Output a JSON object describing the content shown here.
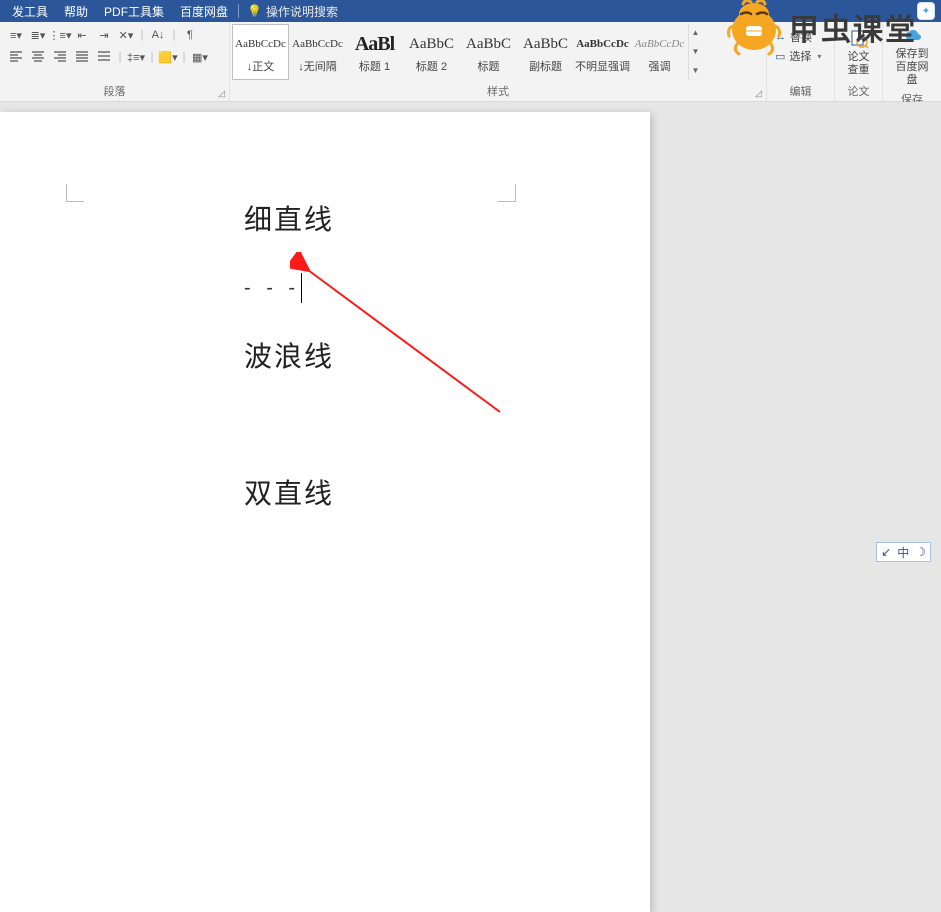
{
  "menubar": {
    "tab_dev": "发工具",
    "tab_help": "帮助",
    "tab_pdf": "PDF工具集",
    "tab_baidu": "百度网盘",
    "search_placeholder": "操作说明搜索"
  },
  "ribbon": {
    "paragraph_label": "段落",
    "styles_label": "样式",
    "edit_label": "编辑",
    "lunwen_label": "论文",
    "baocun_label": "保存",
    "styles": [
      {
        "preview": "AaBbCcDc",
        "name": "↓正文",
        "cls": ""
      },
      {
        "preview": "AaBbCcDc",
        "name": "↓无间隔",
        "cls": ""
      },
      {
        "preview": "AaBl",
        "name": "标题 1",
        "cls": "big"
      },
      {
        "preview": "AaBbC",
        "name": "标题 2",
        "cls": "h"
      },
      {
        "preview": "AaBbC",
        "name": "标题",
        "cls": "h"
      },
      {
        "preview": "AaBbC",
        "name": "副标题",
        "cls": "h"
      },
      {
        "preview": "AaBbCcDc",
        "name": "不明显强调",
        "cls": "subtle"
      },
      {
        "preview": "AaBbCcDc",
        "name": "强调",
        "cls": "subtle"
      }
    ],
    "edit": {
      "replace": "替换",
      "select": "选择"
    },
    "lunwen": "论文\n查重",
    "baocun": "保存到\n百度网盘"
  },
  "document": {
    "line1": "细直线",
    "dashes": "- - -",
    "line2": "波浪线",
    "line3": "双直线"
  },
  "ime": {
    "a": "↙",
    "b": "中",
    "c": "☽"
  },
  "watermark": {
    "text": "甲虫课堂",
    "badge": "✦"
  }
}
